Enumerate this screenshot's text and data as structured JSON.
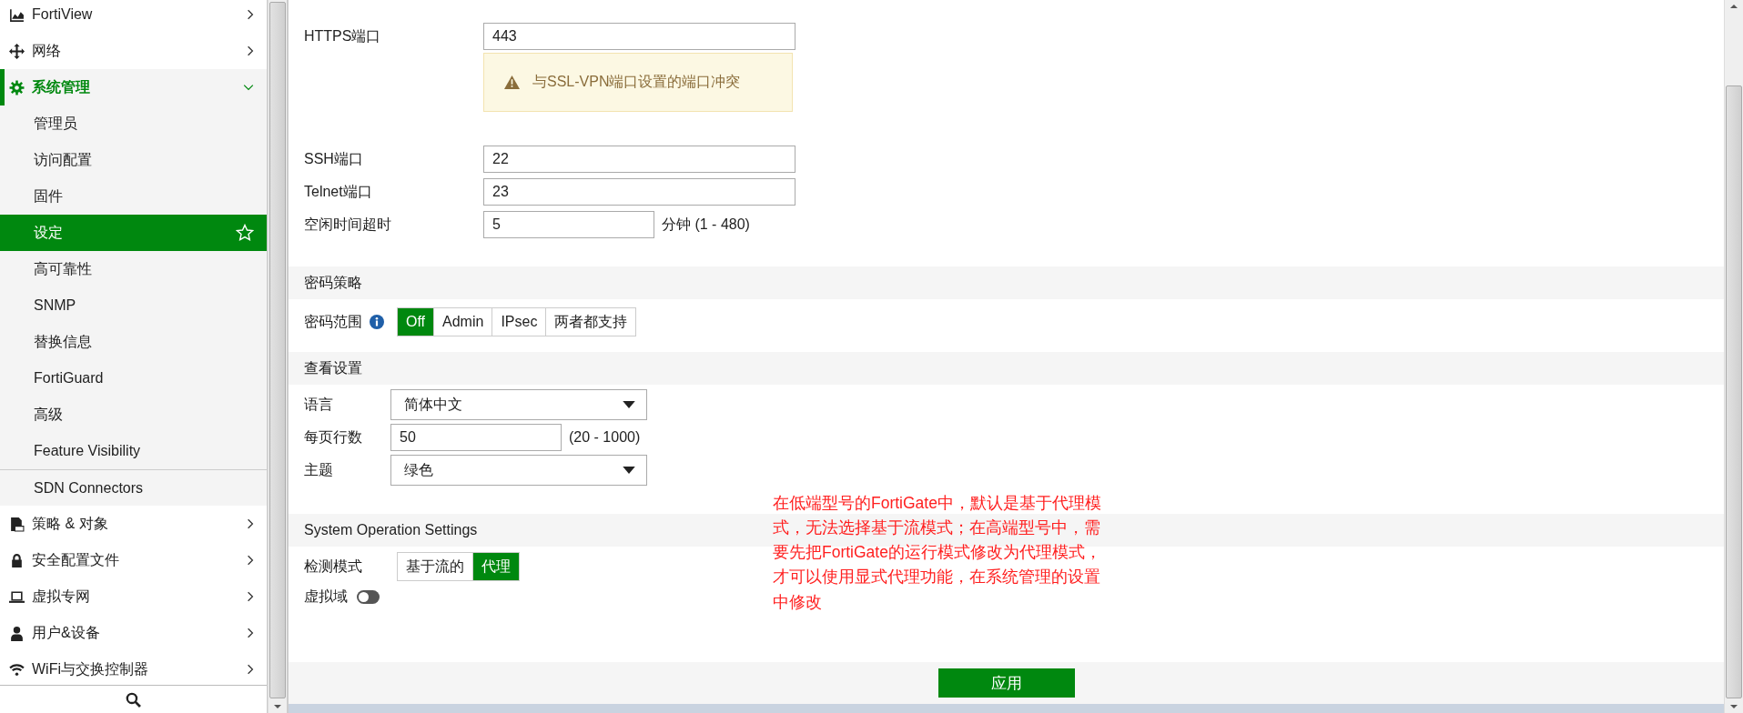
{
  "sidebar": {
    "items": [
      {
        "label": "FortiView",
        "expanded": false
      },
      {
        "label": "网络",
        "expanded": false
      },
      {
        "label": "系统管理",
        "expanded": true,
        "children": [
          {
            "label": "管理员",
            "selected": false,
            "starred": false
          },
          {
            "label": "访问配置",
            "selected": false,
            "starred": false
          },
          {
            "label": "固件",
            "selected": false,
            "starred": false
          },
          {
            "label": "设定",
            "selected": true,
            "starred": true
          },
          {
            "label": "高可靠性",
            "selected": false,
            "starred": false
          },
          {
            "label": "SNMP",
            "selected": false,
            "starred": false
          },
          {
            "label": "替换信息",
            "selected": false,
            "starred": false
          },
          {
            "label": "FortiGuard",
            "selected": false,
            "starred": false
          },
          {
            "label": "高级",
            "selected": false,
            "starred": false
          },
          {
            "label": "Feature Visibility",
            "selected": false,
            "starred": false
          },
          {
            "label": "SDN Connectors",
            "selected": false,
            "starred": false
          }
        ]
      },
      {
        "label": "策略 & 对象",
        "expanded": false
      },
      {
        "label": "安全配置文件",
        "expanded": false
      },
      {
        "label": "虚拟专网",
        "expanded": false
      },
      {
        "label": "用户&设备",
        "expanded": false
      },
      {
        "label": "WiFi与交换控制器",
        "expanded": false
      }
    ]
  },
  "ports": {
    "https": {
      "label": "HTTPS端口",
      "value": "443"
    },
    "warning": "与SSL-VPN端口设置的端口冲突",
    "ssh": {
      "label": "SSH端口",
      "value": "22"
    },
    "telnet": {
      "label": "Telnet端口",
      "value": "23"
    },
    "idle": {
      "label": "空闲时间超时",
      "value": "5",
      "hint": "分钟 (1 - 480)"
    }
  },
  "password_policy": {
    "title": "密码策略",
    "label": "密码范围",
    "options": [
      {
        "label": "Off",
        "selected": true
      },
      {
        "label": "Admin",
        "selected": false
      },
      {
        "label": "IPsec",
        "selected": false
      },
      {
        "label": "两者都支持",
        "selected": false
      }
    ]
  },
  "view_settings": {
    "title": "查看设置",
    "language": {
      "label": "语言",
      "value": "简体中文"
    },
    "rows_per_page": {
      "label": "每页行数",
      "value": "50",
      "hint": "(20 - 1000)"
    },
    "theme": {
      "label": "主题",
      "value": "绿色"
    }
  },
  "system_operation": {
    "title": "System Operation Settings",
    "mode_label": "检测模式",
    "modes": [
      {
        "label": "基于流的",
        "selected": false
      },
      {
        "label": "代理",
        "selected": true
      }
    ],
    "vdom": {
      "label": "虚拟域",
      "on": false
    }
  },
  "annotation": "在低端型号的FortiGate中，默认是基于代理模式，无法选择基于流模式；在高端型号中，需要先把FortiGate的运行模式修改为代理模式，才可以使用显式代理功能，在系统管理的设置中修改",
  "apply_button": "应用"
}
